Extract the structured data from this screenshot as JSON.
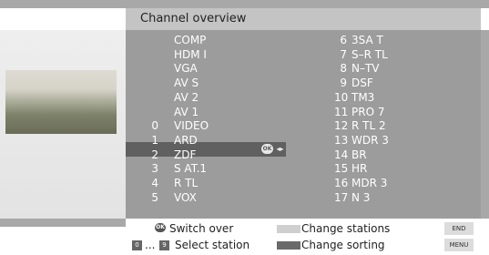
{
  "header": {
    "title": "Channel overview"
  },
  "left_column": [
    {
      "num": "",
      "name": "COMP"
    },
    {
      "num": "",
      "name": "HDM I"
    },
    {
      "num": "",
      "name": "VGA"
    },
    {
      "num": "",
      "name": "AV S"
    },
    {
      "num": "",
      "name": "AV 2"
    },
    {
      "num": "",
      "name": "AV 1"
    },
    {
      "num": "0",
      "name": "VIDEO"
    },
    {
      "num": "1",
      "name": "ARD"
    },
    {
      "num": "2",
      "name": "ZDF"
    },
    {
      "num": "3",
      "name": "S AT.1"
    },
    {
      "num": "4",
      "name": "R TL"
    },
    {
      "num": "5",
      "name": "VOX"
    }
  ],
  "right_column": [
    {
      "num": "6",
      "name": "3SA  T"
    },
    {
      "num": "7",
      "name": "S–R  TL"
    },
    {
      "num": "8",
      "name": "N–TV"
    },
    {
      "num": "9",
      "name": "DSF"
    },
    {
      "num": "10",
      "name": "TM3"
    },
    {
      "num": "11",
      "name": "PRO 7"
    },
    {
      "num": "12",
      "name": "R TL  2"
    },
    {
      "num": "13",
      "name": "WDR  3"
    },
    {
      "num": "14",
      "name": "BR"
    },
    {
      "num": "15",
      "name": "HR"
    },
    {
      "num": "16",
      "name": "MDR  3"
    },
    {
      "num": "17",
      "name": "N 3"
    }
  ],
  "selection": {
    "ok_icon_label": "OK",
    "arrows_icon": "◂▸"
  },
  "footer": {
    "ok_icon_label": "OK",
    "switch_over": "Switch over",
    "key_0": "0",
    "ellipsis": "...",
    "key_9": "9",
    "select_station": "Select station",
    "change_stations": "Change stations",
    "change_sorting": "Change sorting",
    "end_label": "END",
    "menu_label": "MENU"
  },
  "colors": {
    "panel": "#9c9c9c",
    "selected_row": "#606060",
    "header": "#c4c4c4",
    "change_stations_button": "#cfcfcf",
    "change_sorting_button": "#6a6a6a"
  }
}
